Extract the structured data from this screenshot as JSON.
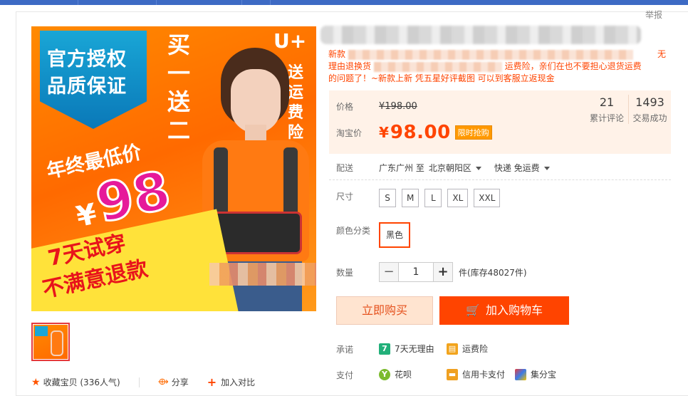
{
  "report_link": "举报",
  "image": {
    "badge_line1": "官方授权",
    "badge_line2": "品质保证",
    "promo_buy": "买一送二",
    "promo_brand": "U+",
    "promo_ship": "送运费险",
    "promo_lowest": "年终最低价",
    "promo_yen": "¥",
    "promo_price": "98",
    "promo_trial": "7天试穿",
    "promo_refund": "不满意退款"
  },
  "description": {
    "line1": "新款",
    "line1_tail": "无",
    "line2_start": "理由退换货",
    "line2_tail": "运费险，亲们在也不要担心退货运费",
    "line3": "的问题了！~新款上新 凭五星好评截图 可以到客服立返现金"
  },
  "price": {
    "label": "价格",
    "original": "¥198.00",
    "taobao_label": "淘宝价",
    "yen": "¥",
    "current": "98.00",
    "promo_tag": "限时抢购"
  },
  "stats": [
    {
      "num": "21",
      "caption": "累计评论"
    },
    {
      "num": "1493",
      "caption": "交易成功"
    }
  ],
  "delivery": {
    "label": "配送",
    "from": "广东广州 至",
    "to": "北京朝阳区",
    "method": "快递 免运费"
  },
  "size": {
    "label": "尺寸",
    "options": [
      "S",
      "M",
      "L",
      "XL",
      "XXL"
    ]
  },
  "color": {
    "label": "颜色分类",
    "selected": "黑色"
  },
  "quantity": {
    "label": "数量",
    "minus": "−",
    "value": "1",
    "plus": "+",
    "stock": "件(库存48027件)"
  },
  "actions": {
    "buy_now": "立即购买",
    "add_cart": "加入购物车"
  },
  "promise": {
    "label": "承诺",
    "items": [
      "7天无理由",
      "运费险"
    ]
  },
  "payment": {
    "label": "支付",
    "items": [
      "花呗",
      "信用卡支付",
      "集分宝"
    ]
  },
  "bottom_links": {
    "favorite": "收藏宝贝 (336人气)",
    "share": "分享",
    "compare": "加入对比"
  },
  "colors": {
    "accent": "#ff4400",
    "price_bg": "#fff2e8",
    "topbar": "#3d6ac4"
  }
}
